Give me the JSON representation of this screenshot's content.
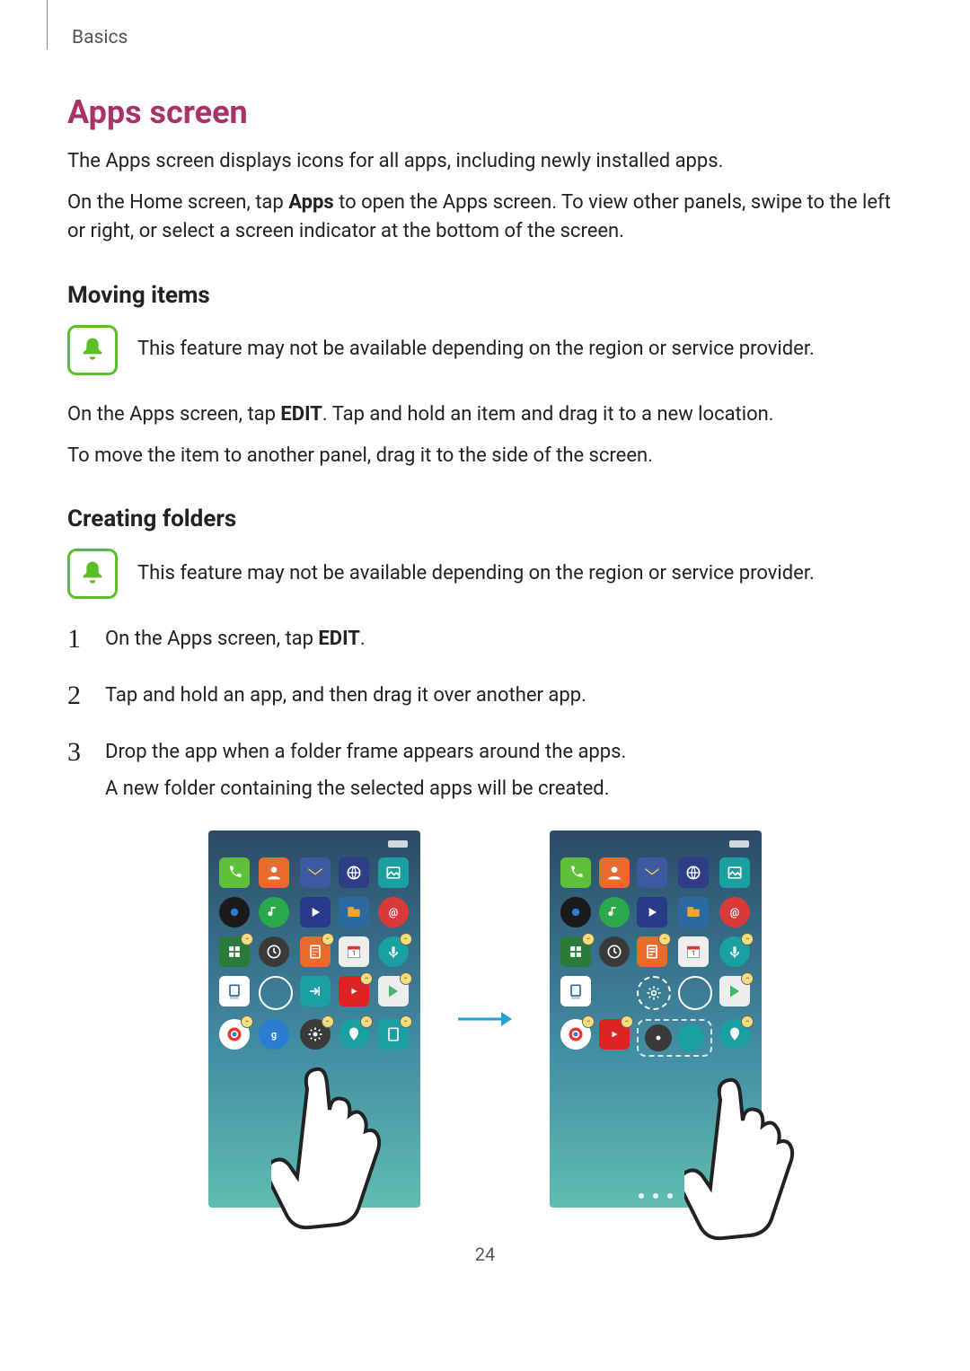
{
  "header": {
    "category": "Basics"
  },
  "section": {
    "title": "Apps screen",
    "intro1": "The Apps screen displays icons for all apps, including newly installed apps.",
    "intro2_pre": "On the Home screen, tap ",
    "intro2_bold": "Apps",
    "intro2_post": " to open the Apps screen. To view other panels, swipe to the left or right, or select a screen indicator at the bottom of the screen."
  },
  "moving": {
    "title": "Moving items",
    "note": "This feature may not be available depending on the region or service provider.",
    "p1_pre": "On the Apps screen, tap ",
    "p1_bold": "EDIT",
    "p1_post": ". Tap and hold an item and drag it to a new location.",
    "p2": "To move the item to another panel, drag it to the side of the screen."
  },
  "creating": {
    "title": "Creating folders",
    "note": "This feature may not be available depending on the region or service provider.",
    "steps": [
      {
        "pre": "On the Apps screen, tap ",
        "bold": "EDIT",
        "post": "."
      },
      {
        "text": "Tap and hold an app, and then drag it over another app."
      },
      {
        "text": "Drop the app when a folder frame appears around the apps.",
        "sub": "A new folder containing the selected apps will be created."
      }
    ]
  },
  "page_number": "24"
}
